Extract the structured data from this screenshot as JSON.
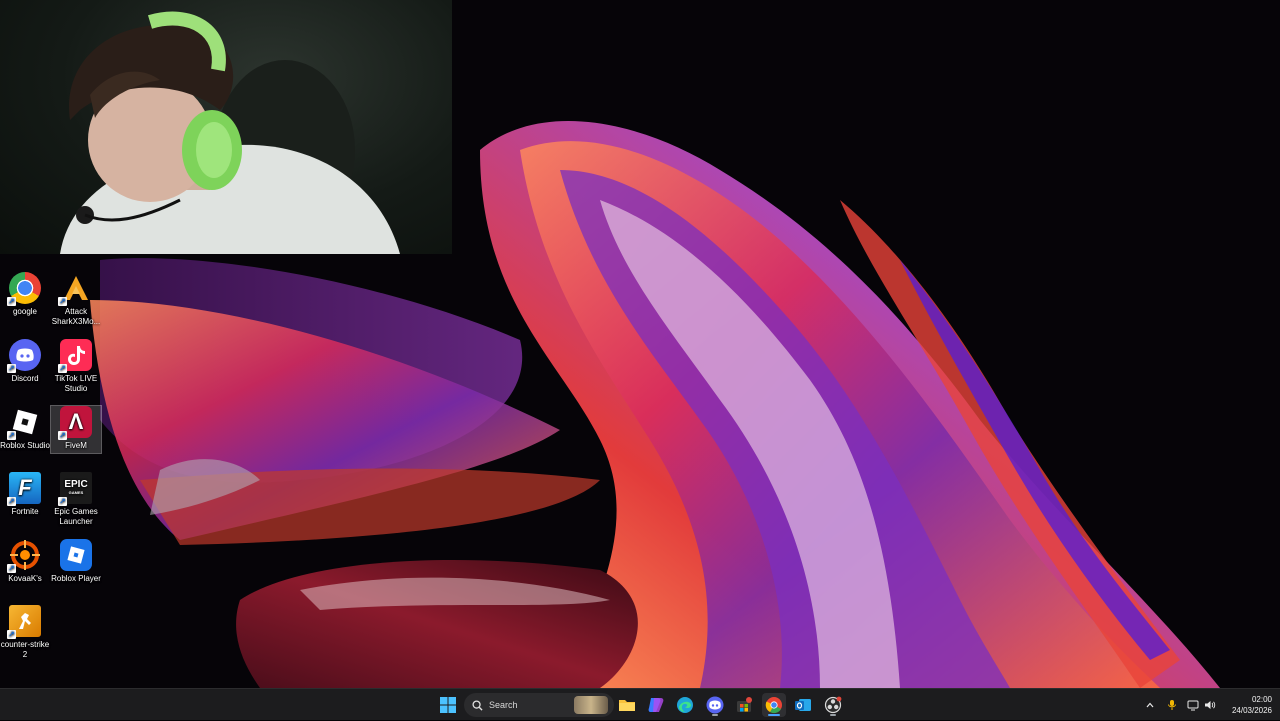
{
  "desktop": {
    "icons": [
      {
        "label": "google",
        "icon": "chrome-icon",
        "color": "#e8eaed"
      },
      {
        "label": "Attack SharkX3Mo...",
        "icon": "attack-shark-icon",
        "color": "#f5a623"
      },
      {
        "label": "Discord",
        "icon": "discord-icon",
        "color": "#5865f2"
      },
      {
        "label": "TikTok LIVE Studio",
        "icon": "tiktok-live-icon",
        "color": "#fe2c55"
      },
      {
        "label": "Roblox Studio",
        "icon": "roblox-studio-icon",
        "color": "#111111"
      },
      {
        "label": "FiveM",
        "icon": "fivem-icon",
        "color": "#c0143c"
      },
      {
        "label": "Fortnite",
        "icon": "fortnite-icon",
        "color": "#1e88e5"
      },
      {
        "label": "Epic Games Launcher",
        "icon": "epic-games-icon",
        "color": "#222222"
      },
      {
        "label": "KovaaK's",
        "icon": "kovaaks-icon",
        "color": "#e65100"
      },
      {
        "label": "Roblox Player",
        "icon": "roblox-player-icon",
        "color": "#1a73e8"
      },
      {
        "label": "counter-strike 2",
        "icon": "counter-strike-icon",
        "color": "#f0a500"
      }
    ],
    "icon_glyphs": {
      "epic": "EPIC",
      "epic_sub": "GAMES",
      "fortnite": "F",
      "fivem": "Λ"
    }
  },
  "taskbar": {
    "search_placeholder": "Search",
    "clock_time": "02:00",
    "clock_date": "24/03/2026",
    "apps": [
      {
        "name": "start-icon"
      },
      {
        "name": "search-icon"
      },
      {
        "name": "file-explorer-icon"
      },
      {
        "name": "copilot-icon"
      },
      {
        "name": "edge-icon"
      },
      {
        "name": "discord-taskbar-icon"
      },
      {
        "name": "store-icon"
      },
      {
        "name": "chrome-taskbar-icon"
      },
      {
        "name": "outlook-icon"
      },
      {
        "name": "obs-icon"
      }
    ],
    "tray": [
      "chevron-up-icon",
      "microphone-icon",
      "network-icon",
      "volume-icon"
    ],
    "accent": "#4aa3ff"
  }
}
